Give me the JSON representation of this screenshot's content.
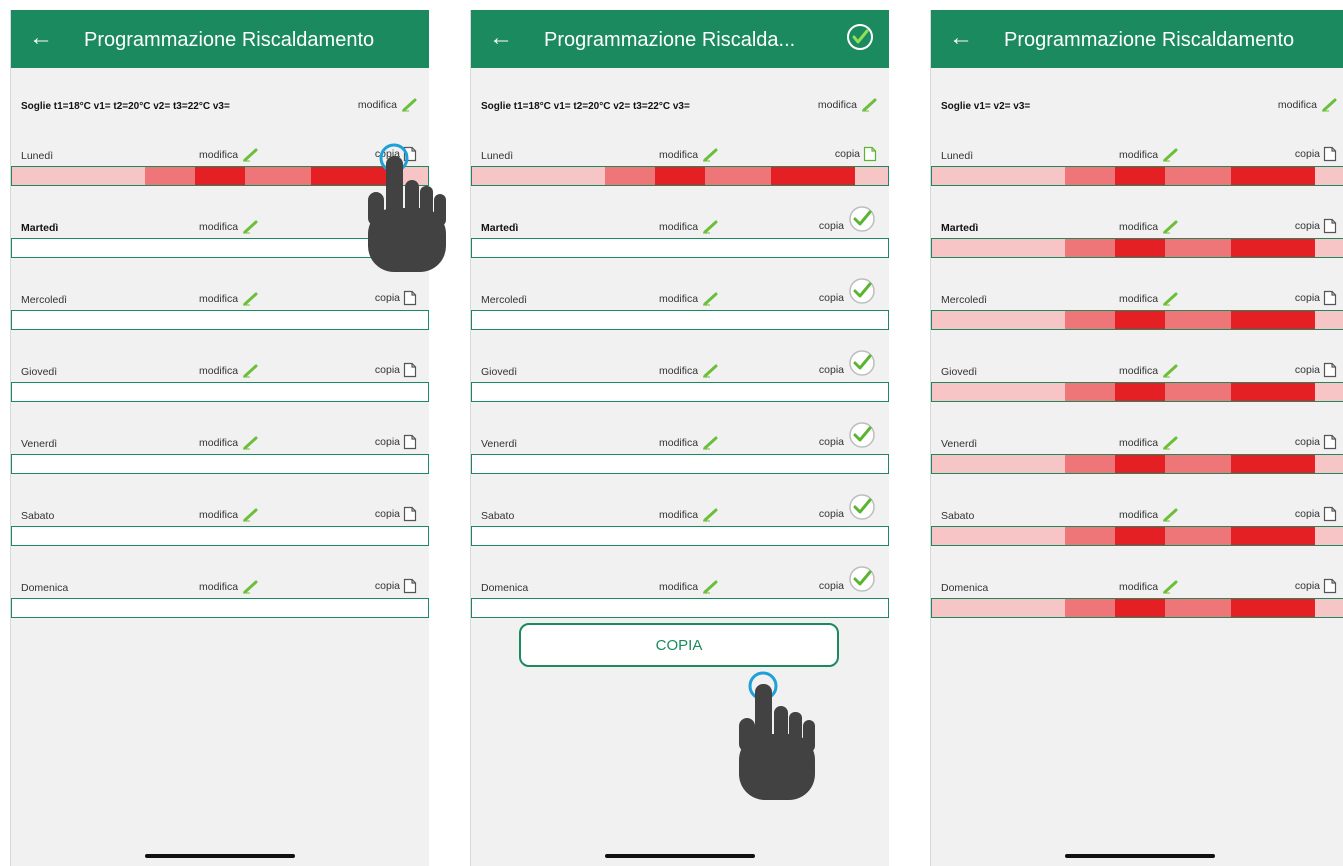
{
  "colors": {
    "header": "#1b8a5e",
    "heat_low": "#f8c5c7",
    "heat_mid": "#ee7678",
    "heat_high": "#e52024"
  },
  "icons": {
    "back": "back-arrow-icon",
    "edit": "pencil-icon",
    "copy": "copy-page-icon",
    "check": "check-circle-icon",
    "hand": "hand-pointer-icon"
  },
  "panel1": {
    "title": "Programmazione Riscaldamento",
    "soglie": "Soglie t1=18°C v1= t2=20°C v2= t3=22°C v3=",
    "modifica": "modifica",
    "days": [
      {
        "name": "Lunedì",
        "modifica": "modifica",
        "copia": "copia",
        "heat_shown": true
      },
      {
        "name": "Martedì",
        "modifica": "modifica",
        "copia": "copia",
        "heat_shown": false
      },
      {
        "name": "Mercoledì",
        "modifica": "modifica",
        "copia": "copia",
        "heat_shown": false
      },
      {
        "name": "Giovedì",
        "modifica": "modifica",
        "copia": "copia",
        "heat_shown": false
      },
      {
        "name": "Venerdì",
        "modifica": "modifica",
        "copia": "copia",
        "heat_shown": false
      },
      {
        "name": "Sabato",
        "modifica": "modifica",
        "copia": "copia",
        "heat_shown": false
      },
      {
        "name": "Domenica",
        "modifica": "modifica",
        "copia": "copia",
        "heat_shown": false
      }
    ]
  },
  "panel2": {
    "title": "Programmazione Riscalda...",
    "soglie": "Soglie t1=18°C v1= t2=20°C v2= t3=22°C v3=",
    "modifica": "modifica",
    "button": "COPIA",
    "days": [
      {
        "name": "Lunedì",
        "modifica": "modifica",
        "copia": "copia",
        "selected": false,
        "heat_shown": true
      },
      {
        "name": "Martedì",
        "modifica": "modifica",
        "copia": "copia",
        "selected": true,
        "heat_shown": false
      },
      {
        "name": "Mercoledì",
        "modifica": "modifica",
        "copia": "copia",
        "selected": true,
        "heat_shown": false
      },
      {
        "name": "Giovedì",
        "modifica": "modifica",
        "copia": "copia",
        "selected": true,
        "heat_shown": false
      },
      {
        "name": "Venerdì",
        "modifica": "modifica",
        "copia": "copia",
        "selected": true,
        "heat_shown": false
      },
      {
        "name": "Sabato",
        "modifica": "modifica",
        "copia": "copia",
        "selected": true,
        "heat_shown": false
      },
      {
        "name": "Domenica",
        "modifica": "modifica",
        "copia": "copia",
        "selected": true,
        "heat_shown": false
      }
    ]
  },
  "panel3": {
    "title": "Programmazione Riscaldamento",
    "soglie": "Soglie v1= v2= v3=",
    "modifica": "modifica",
    "days": [
      {
        "name": "Lunedì",
        "modifica": "modifica",
        "copia": "copia",
        "heat_shown": true
      },
      {
        "name": "Martedì",
        "modifica": "modifica",
        "copia": "copia",
        "heat_shown": true
      },
      {
        "name": "Mercoledì",
        "modifica": "modifica",
        "copia": "copia",
        "heat_shown": true
      },
      {
        "name": "Giovedì",
        "modifica": "modifica",
        "copia": "copia",
        "heat_shown": true
      },
      {
        "name": "Venerdì",
        "modifica": "modifica",
        "copia": "copia",
        "heat_shown": true
      },
      {
        "name": "Sabato",
        "modifica": "modifica",
        "copia": "copia",
        "heat_shown": true
      },
      {
        "name": "Domenica",
        "modifica": "modifica",
        "copia": "copia",
        "heat_shown": true
      }
    ]
  }
}
